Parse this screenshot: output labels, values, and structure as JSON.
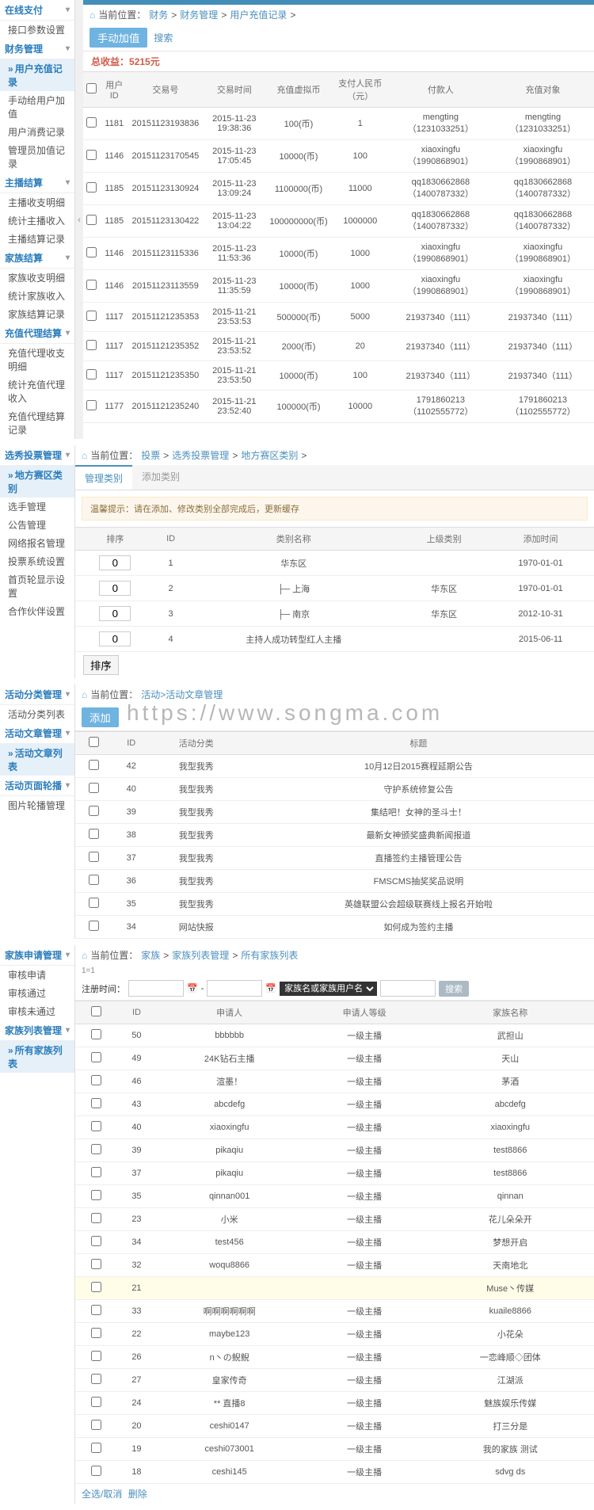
{
  "sec1": {
    "sidebar": [
      {
        "type": "header",
        "label": "在线支付"
      },
      {
        "type": "item",
        "label": "接口参数设置"
      },
      {
        "type": "header",
        "label": "财务管理"
      },
      {
        "type": "item",
        "label": "用户充值记录",
        "active": true
      },
      {
        "type": "item",
        "label": "手动给用户加值"
      },
      {
        "type": "item",
        "label": "用户消费记录"
      },
      {
        "type": "item",
        "label": "管理员加值记录"
      },
      {
        "type": "header",
        "label": "主播结算"
      },
      {
        "type": "item",
        "label": "主播收支明细"
      },
      {
        "type": "item",
        "label": "统计主播收入"
      },
      {
        "type": "item",
        "label": "主播结算记录"
      },
      {
        "type": "header",
        "label": "家族结算"
      },
      {
        "type": "item",
        "label": "家族收支明细"
      },
      {
        "type": "item",
        "label": "统计家族收入"
      },
      {
        "type": "item",
        "label": "家族结算记录"
      },
      {
        "type": "header",
        "label": "充值代理结算"
      },
      {
        "type": "item",
        "label": "充值代理收支明细"
      },
      {
        "type": "item",
        "label": "统计充值代理收入"
      },
      {
        "type": "item",
        "label": "充值代理结算记录"
      }
    ],
    "breadcrumb": [
      "当前位置：",
      "财务",
      " > ",
      "财务管理",
      " > ",
      "用户充值记录",
      " > "
    ],
    "btn_manual": "手动加值",
    "btn_search": "搜索",
    "revenue_label": "总收益：",
    "revenue_value": "5215元",
    "headers": [
      "",
      "用户ID",
      "交易号",
      "交易时间",
      "充值虚拟币",
      "支付人民币（元）",
      "付款人",
      "充值对象"
    ],
    "rows": [
      [
        "",
        "1181",
        "20151123193836",
        "2015-11-23 19:38:36",
        "100(币)",
        "1",
        "mengting（1231033251）",
        "mengting（1231033251）"
      ],
      [
        "",
        "1146",
        "20151123170545",
        "2015-11-23 17:05:45",
        "10000(币)",
        "100",
        "xiaoxingfu（1990868901）",
        "xiaoxingfu（1990868901）"
      ],
      [
        "",
        "1185",
        "20151123130924",
        "2015-11-23 13:09:24",
        "1100000(币)",
        "11000",
        "qq1830662868（1400787332）",
        "qq1830662868（1400787332）"
      ],
      [
        "",
        "1185",
        "20151123130422",
        "2015-11-23 13:04:22",
        "100000000(币)",
        "1000000",
        "qq1830662868（1400787332）",
        "qq1830662868（1400787332）"
      ],
      [
        "",
        "1146",
        "20151123115336",
        "2015-11-23 11:53:36",
        "10000(币)",
        "1000",
        "xiaoxingfu（1990868901）",
        "xiaoxingfu（1990868901）"
      ],
      [
        "",
        "1146",
        "20151123113559",
        "2015-11-23 11:35:59",
        "10000(币)",
        "1000",
        "xiaoxingfu（1990868901）",
        "xiaoxingfu（1990868901）"
      ],
      [
        "",
        "1117",
        "20151121235353",
        "2015-11-21 23:53:53",
        "500000(币)",
        "5000",
        "21937340（111）",
        "21937340（111）"
      ],
      [
        "",
        "1117",
        "20151121235352",
        "2015-11-21 23:53:52",
        "2000(币)",
        "20",
        "21937340（111）",
        "21937340（111）"
      ],
      [
        "",
        "1117",
        "20151121235350",
        "2015-11-21 23:53:50",
        "10000(币)",
        "100",
        "21937340（111）",
        "21937340（111）"
      ],
      [
        "",
        "1177",
        "20151121235240",
        "2015-11-21 23:52:40",
        "100000(币)",
        "10000",
        "1791860213（1102555772）",
        "1791860213（1102555772）"
      ]
    ]
  },
  "sec2": {
    "sidebar": [
      {
        "type": "header",
        "label": "选秀投票管理"
      },
      {
        "type": "item",
        "label": "地方赛区类别",
        "active": true
      },
      {
        "type": "item",
        "label": "选手管理"
      },
      {
        "type": "item",
        "label": "公告管理"
      },
      {
        "type": "item",
        "label": "网络报名管理"
      },
      {
        "type": "item",
        "label": "投票系统设置"
      },
      {
        "type": "item",
        "label": "首页轮显示设置"
      },
      {
        "type": "item",
        "label": "合作伙伴设置"
      }
    ],
    "breadcrumb": [
      "当前位置：",
      "投票",
      " > ",
      "选秀投票管理",
      " > ",
      "地方赛区类别",
      " > "
    ],
    "tab_manage": "管理类别",
    "tab_add": "添加类别",
    "tip": "温馨提示：请在添加、修改类别全部完成后，更新缓存",
    "headers": [
      "排序",
      "ID",
      "类别名称",
      "上级类别",
      "添加时间"
    ],
    "rows": [
      [
        "0",
        "1",
        "华东区",
        "",
        "1970-01-01"
      ],
      [
        "0",
        "2",
        "├─ 上海",
        "华东区",
        "1970-01-01"
      ],
      [
        "0",
        "3",
        "├─ 南京",
        "华东区",
        "2012-10-31"
      ],
      [
        "0",
        "4",
        "主持人成功转型红人主播",
        "",
        "2015-06-11"
      ]
    ],
    "sort_btn": "排序"
  },
  "sec3": {
    "sidebar": [
      {
        "type": "header",
        "label": "活动分类管理"
      },
      {
        "type": "item",
        "label": "活动分类列表"
      },
      {
        "type": "header",
        "label": "活动文章管理"
      },
      {
        "type": "item",
        "label": "活动文章列表",
        "active": true
      },
      {
        "type": "header",
        "label": "活动页面轮播"
      },
      {
        "type": "item",
        "label": "图片轮播管理"
      }
    ],
    "breadcrumb": [
      "当前位置：",
      "活动>活动文章管理"
    ],
    "btn_add": "添加",
    "watermark": "https://www.songma.com",
    "headers": [
      "",
      "ID",
      "活动分类",
      "标题"
    ],
    "rows": [
      [
        "",
        "42",
        "我型我秀",
        "10月12日2015赛程延期公告"
      ],
      [
        "",
        "40",
        "我型我秀",
        "守护系统修复公告"
      ],
      [
        "",
        "39",
        "我型我秀",
        "集结吧！女神的圣斗士！"
      ],
      [
        "",
        "38",
        "我型我秀",
        "最新女神颁奖盛典新闻报道"
      ],
      [
        "",
        "37",
        "我型我秀",
        "直播签约主播管理公告"
      ],
      [
        "",
        "36",
        "我型我秀",
        "FMSCMS抽奖奖品说明"
      ],
      [
        "",
        "35",
        "我型我秀",
        "英雄联盟公会超级联赛线上报名开始啦"
      ],
      [
        "",
        "34",
        "网站快报",
        "如何成为签约主播"
      ]
    ]
  },
  "sec4": {
    "sidebar": [
      {
        "type": "header",
        "label": "家族申请管理"
      },
      {
        "type": "item",
        "label": "审核申请"
      },
      {
        "type": "item",
        "label": "审核通过"
      },
      {
        "type": "item",
        "label": "审核未通过"
      },
      {
        "type": "header",
        "label": "家族列表管理"
      },
      {
        "type": "item",
        "label": "所有家族列表",
        "active": true
      }
    ],
    "breadcrumb": [
      "当前位置：",
      "家族",
      " > ",
      "家族列表管理",
      " > ",
      "所有家族列表"
    ],
    "eq": "1=1",
    "filter_label": "注册时间：",
    "filter_select": "家族名或家族用户名",
    "btn_search": "搜索",
    "headers": [
      "",
      "ID",
      "申请人",
      "申请人等级",
      "家族名称"
    ],
    "rows": [
      [
        "",
        "50",
        "bbbbbb",
        "一级主播",
        "武担山"
      ],
      [
        "",
        "49",
        "24K钻石主播",
        "一级主播",
        "天山"
      ],
      [
        "",
        "46",
        "渲墨！",
        "一级主播",
        "茅酒"
      ],
      [
        "",
        "43",
        "abcdefg",
        "一级主播",
        "abcdefg"
      ],
      [
        "",
        "40",
        "xiaoxingfu",
        "一级主播",
        "xiaoxingfu"
      ],
      [
        "",
        "39",
        "pikaqiu",
        "一级主播",
        "test8866"
      ],
      [
        "",
        "37",
        "pikaqiu",
        "一级主播",
        "test8866"
      ],
      [
        "",
        "35",
        "qinnan001",
        "一级主播",
        "qinnan"
      ],
      [
        "",
        "23",
        "小米",
        "一级主播",
        "花儿朵朵开"
      ],
      [
        "",
        "34",
        "test456",
        "一级主播",
        "梦想开启"
      ],
      [
        "",
        "32",
        "woqu8866",
        "一级主播",
        "天南地北"
      ],
      [
        "hl",
        "21",
        "",
        "",
        "Muse丶传媒"
      ],
      [
        "",
        "33",
        "啊啊啊啊啊啊",
        "一级主播",
        "kuaile8866"
      ],
      [
        "",
        "22",
        "maybe123",
        "一级主播",
        "小花朵"
      ],
      [
        "",
        "26",
        "n丶の鲵鲵",
        "一级主播",
        "一恋峰顺◇团体"
      ],
      [
        "",
        "27",
        "皇家传奇",
        "一级主播",
        "江湖派"
      ],
      [
        "",
        "24",
        "** 直播8",
        "一级主播",
        "魅族娱乐传媒"
      ],
      [
        "",
        "20",
        "ceshi0147",
        "一级主播",
        "打三分是"
      ],
      [
        "",
        "19",
        "ceshi073001",
        "一级主播",
        "我的家族 测试"
      ],
      [
        "",
        "18",
        "ceshi145",
        "一级主播",
        "sdvg ds"
      ]
    ],
    "select_all": "全选/取消",
    "del": "删除"
  }
}
